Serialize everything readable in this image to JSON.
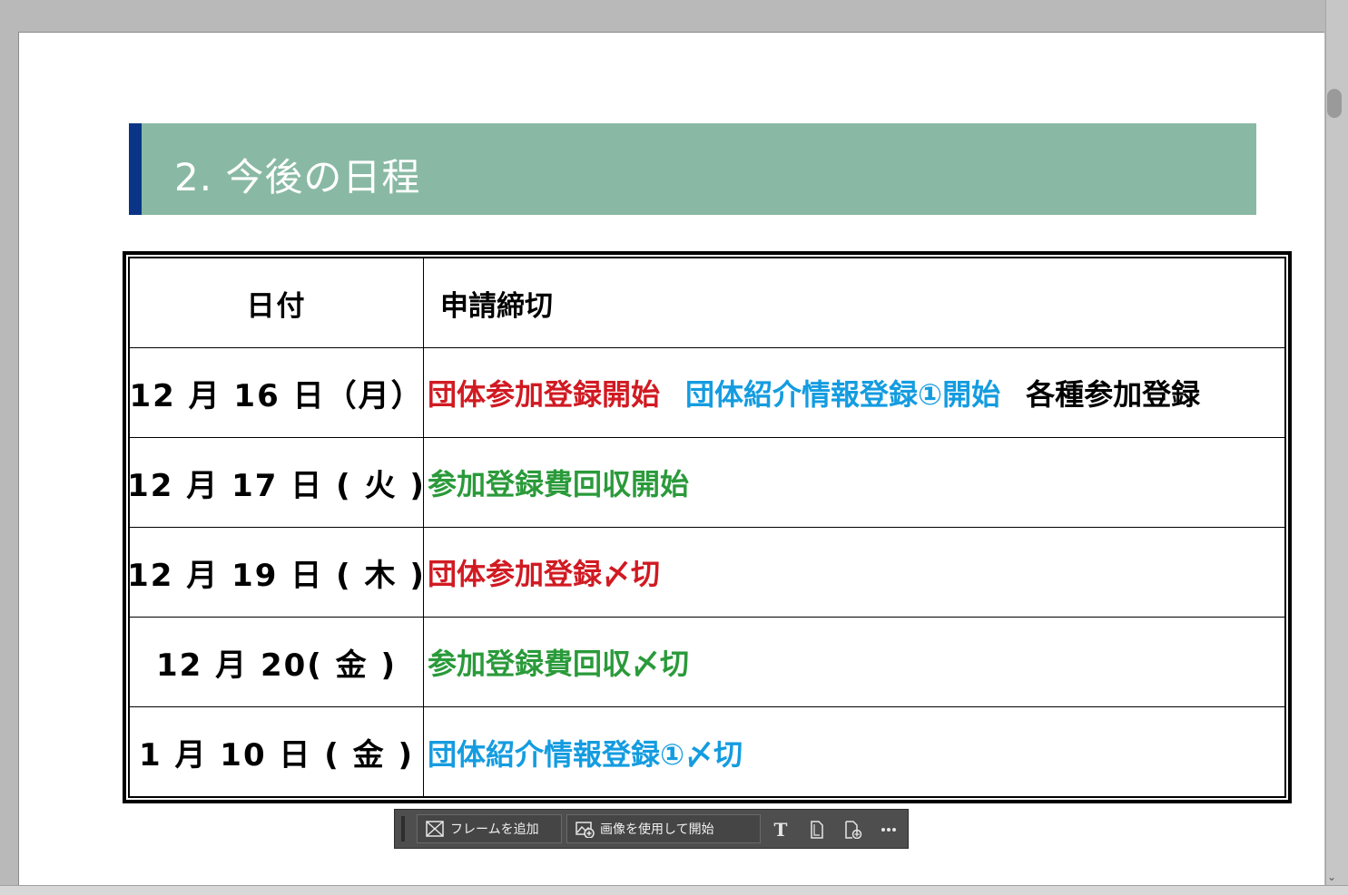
{
  "section": {
    "title": "2. 今後の日程"
  },
  "table": {
    "header": {
      "date": "日付",
      "item": "申請締切"
    },
    "rows": [
      {
        "date": "12 月 16 日（月）",
        "segments": [
          {
            "text": "団体参加登録開始",
            "color": "#d11a22"
          },
          {
            "text": "団体紹介情報登録①開始",
            "color": "#149ce0"
          },
          {
            "text": "各種参加登録",
            "color": "#000000"
          }
        ]
      },
      {
        "date": "12 月 17 日 ( 火 )",
        "segments": [
          {
            "text": "参加登録費回収開始",
            "color": "#2a9a3a"
          }
        ]
      },
      {
        "date": "12 月 19 日 ( 木 )",
        "segments": [
          {
            "text": "団体参加登録〆切",
            "color": "#d11a22"
          }
        ]
      },
      {
        "date": "12 月 20( 金 )",
        "segments": [
          {
            "text": "参加登録費回収〆切",
            "color": "#2a9a3a"
          }
        ]
      },
      {
        "date": "1 月 10 日 ( 金 )",
        "segments": [
          {
            "text": "団体紹介情報登録①〆切",
            "color": "#149ce0"
          }
        ]
      }
    ]
  },
  "toolbar": {
    "add_frame_label": "フレームを追加",
    "start_with_image_label": "画像を使用して開始",
    "icons": [
      "frame-icon",
      "image-add-icon",
      "text-tool-icon",
      "page-icon",
      "page-add-icon",
      "more-icon"
    ]
  },
  "colors": {
    "heading_bg": "#89b9a4",
    "heading_accent": "#0a3587",
    "red": "#d11a22",
    "blue": "#149ce0",
    "green": "#2a9a3a"
  }
}
